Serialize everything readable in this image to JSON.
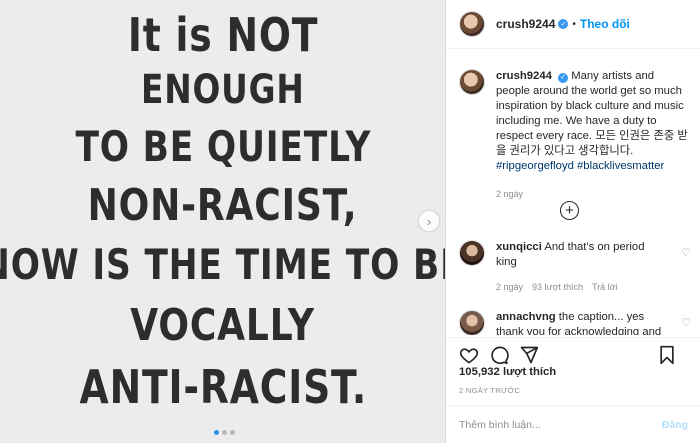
{
  "poster": {
    "lines": [
      "It is NOT",
      "ENOUGH",
      "TO BE QUIETLY",
      "NON-RACIST,",
      "NOW IS THE TIME TO BE",
      "VOCALLY",
      "ANTI-RACIST."
    ],
    "carousel_total": 3,
    "carousel_active": 1
  },
  "header": {
    "username": "crush9244",
    "separator": "•",
    "follow_label": "Theo dõi"
  },
  "caption": {
    "username": "crush9244",
    "text": "Many artists and people around the world get so much inspiration by black culture and music including me. We have a duty to respect every race. 모든 인권은 존중 받을 권리가 있다고 생각합니다.",
    "hashtags": "#ripgeorgefloyd #blacklivesmatter",
    "time": "2 ngày"
  },
  "load_more_symbol": "+",
  "comments": [
    {
      "username": "xunqicci",
      "text": "And that's on period king",
      "time": "2 ngày",
      "likes": "93 lượt thích",
      "reply": "Trả lời"
    },
    {
      "username": "annachvng",
      "text": "the caption... yes thank you for acknowledging and",
      "time": "",
      "likes": "",
      "reply": ""
    }
  ],
  "actions": {
    "likes": "105,932 lượt thích",
    "date": "2 NGÀY TRƯỚC"
  },
  "comment_box": {
    "placeholder": "Thêm bình luận...",
    "post_label": "Đăng"
  }
}
